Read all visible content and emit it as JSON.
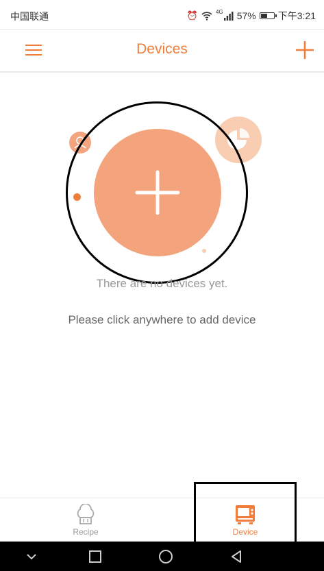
{
  "status_bar": {
    "carrier": "中国联通",
    "network": "4G",
    "battery": "57%",
    "battery_level": 0.57,
    "time": "下午3:21"
  },
  "header": {
    "title": "Devices",
    "menu_icon": "hamburger-menu-icon",
    "add_icon": "plus-icon"
  },
  "main": {
    "empty_message": "There are no devices yet.",
    "hint": "Please click anywhere to add device",
    "add_icon": "plus-icon"
  },
  "tabbar": {
    "tabs": [
      {
        "label": "Recipe",
        "icon": "chef-hat-icon",
        "active": false
      },
      {
        "label": "Device",
        "icon": "device-icon",
        "active": true
      }
    ]
  },
  "colors": {
    "accent": "#f07d3a",
    "accent_light": "#f4a47c",
    "accent_pale": "#f9cdb2"
  }
}
